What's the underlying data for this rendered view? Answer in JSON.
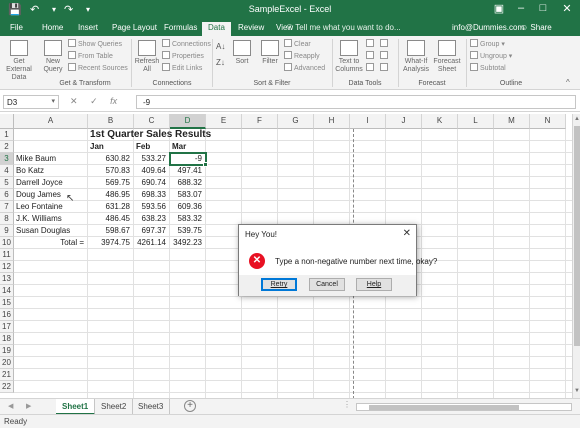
{
  "window": {
    "title": "SampleExcel - Excel"
  },
  "tabs": [
    "File",
    "Home",
    "Insert",
    "Page Layout",
    "Formulas",
    "Data",
    "Review",
    "View"
  ],
  "active_tab": "Data",
  "tell_me": "Tell me what you want to do...",
  "account": {
    "email": "info@Dummies.com",
    "share": "Share"
  },
  "ribbon": {
    "get_external_data": "Get External Data",
    "new_query": "New Query",
    "show_queries": "Show Queries",
    "from_table": "From Table",
    "recent_sources": "Recent Sources",
    "refresh_all": "Refresh All",
    "connections": "Connections",
    "properties": "Properties",
    "edit_links": "Edit Links",
    "sort": "Sort",
    "filter": "Filter",
    "clear": "Clear",
    "reapply": "Reapply",
    "advanced": "Advanced",
    "text_to_columns": "Text to Columns",
    "what_if": "What-If Analysis",
    "forecast_sheet": "Forecast Sheet",
    "group": "Group",
    "ungroup": "Ungroup",
    "subtotal": "Subtotal",
    "groups": [
      "Get & Transform",
      "Connections",
      "Sort & Filter",
      "Data Tools",
      "Forecast",
      "Outline"
    ]
  },
  "formula_bar": {
    "name_box": "D3",
    "formula": "-9"
  },
  "columns": [
    "A",
    "B",
    "C",
    "D",
    "E",
    "F",
    "G",
    "H",
    "I",
    "J",
    "K",
    "L",
    "M",
    "N"
  ],
  "rows": [
    "1",
    "2",
    "3",
    "4",
    "5",
    "6",
    "7",
    "8",
    "9",
    "10",
    "11",
    "12",
    "13",
    "14",
    "15",
    "16",
    "17",
    "18",
    "19",
    "20",
    "21",
    "22"
  ],
  "sheet": {
    "title": "1st Quarter Sales Results",
    "headers": [
      "Jan",
      "Feb",
      "Mar"
    ],
    "data": [
      {
        "name": "Mike Baum",
        "jan": "630.82",
        "feb": "533.27",
        "mar": "-9"
      },
      {
        "name": "Bo Katz",
        "jan": "570.83",
        "feb": "409.64",
        "mar": "497.41"
      },
      {
        "name": "Darrell Joyce",
        "jan": "569.75",
        "feb": "690.74",
        "mar": "688.32"
      },
      {
        "name": "Doug James",
        "jan": "486.95",
        "feb": "698.33",
        "mar": "583.07"
      },
      {
        "name": "Leo Fontaine",
        "jan": "631.28",
        "feb": "593.56",
        "mar": "609.36"
      },
      {
        "name": "J.K. Williams",
        "jan": "486.45",
        "feb": "638.23",
        "mar": "583.32"
      },
      {
        "name": "Susan Douglas",
        "jan": "598.67",
        "feb": "697.37",
        "mar": "539.75"
      }
    ],
    "total_label": "Total =",
    "totals": {
      "jan": "3974.75",
      "feb": "4261.14",
      "mar": "3492.23"
    }
  },
  "sheet_tabs": [
    "Sheet1",
    "Sheet2",
    "Sheet3"
  ],
  "active_sheet": "Sheet1",
  "status": "Ready",
  "dialog": {
    "title": "Hey You!",
    "message": "Type a non-negative number next time, okay?",
    "buttons": [
      "Retry",
      "Cancel",
      "Help"
    ]
  },
  "colors": {
    "accent": "#217346",
    "error": "#e81123"
  }
}
